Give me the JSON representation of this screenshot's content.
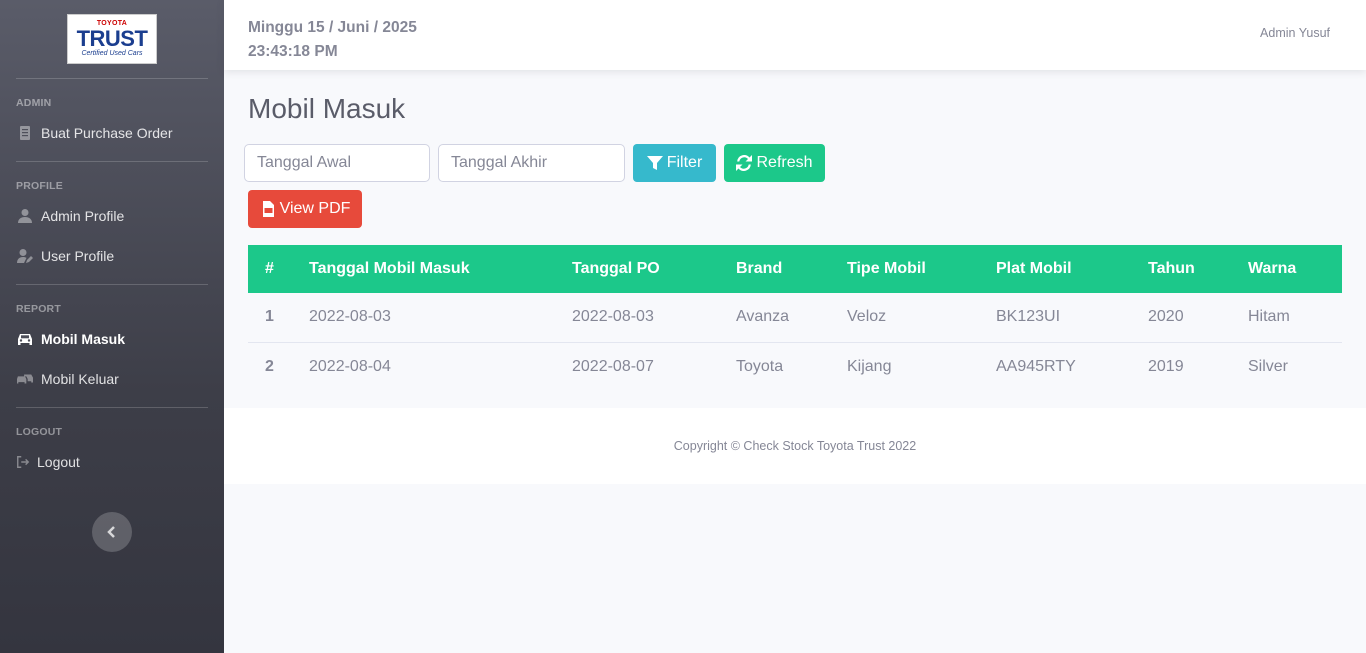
{
  "sidebar": {
    "logo": {
      "brand": "TOYOTA",
      "name": "TRUST",
      "tagline": "Certified Used Cars"
    },
    "sections": {
      "admin": {
        "heading": "ADMIN",
        "items": [
          {
            "label": "Buat Purchase Order",
            "icon": "document-icon"
          }
        ]
      },
      "profile": {
        "heading": "PROFILE",
        "items": [
          {
            "label": "Admin Profile",
            "icon": "user-icon"
          },
          {
            "label": "User Profile",
            "icon": "user-edit-icon"
          }
        ]
      },
      "report": {
        "heading": "REPORT",
        "items": [
          {
            "label": "Mobil Masuk",
            "icon": "car-icon",
            "active": true
          },
          {
            "label": "Mobil Keluar",
            "icon": "cars-icon"
          }
        ]
      },
      "logout": {
        "heading": "LOGOUT",
        "items": [
          {
            "label": "Logout",
            "icon": "logout-icon"
          }
        ]
      }
    }
  },
  "topbar": {
    "date": "Minggu 15 / Juni / 2025",
    "time": "23:43:18 PM",
    "user": "Admin Yusuf"
  },
  "main": {
    "title": "Mobil Masuk",
    "filters": {
      "start_placeholder": "Tanggal Awal",
      "end_placeholder": "Tanggal Akhir",
      "filter_label": "Filter",
      "refresh_label": "Refresh",
      "pdf_label": "View PDF"
    },
    "table": {
      "columns": [
        "#",
        "Tanggal Mobil Masuk",
        "Tanggal PO",
        "Brand",
        "Tipe Mobil",
        "Plat Mobil",
        "Tahun",
        "Warna"
      ],
      "rows": [
        [
          "1",
          "2022-08-03",
          "2022-08-03",
          "Avanza",
          "Veloz",
          "BK123UI",
          "2020",
          "Hitam"
        ],
        [
          "2",
          "2022-08-04",
          "2022-08-07",
          "Toyota",
          "Kijang",
          "AA945RTY",
          "2019",
          "Silver"
        ]
      ]
    }
  },
  "footer": {
    "copyright": "Copyright © Check Stock Toyota Trust 2022"
  },
  "colors": {
    "primary_green": "#1cc88a",
    "info": "#36b9cc",
    "danger": "#e74a3b",
    "sidebar": "#4e4f5a"
  }
}
